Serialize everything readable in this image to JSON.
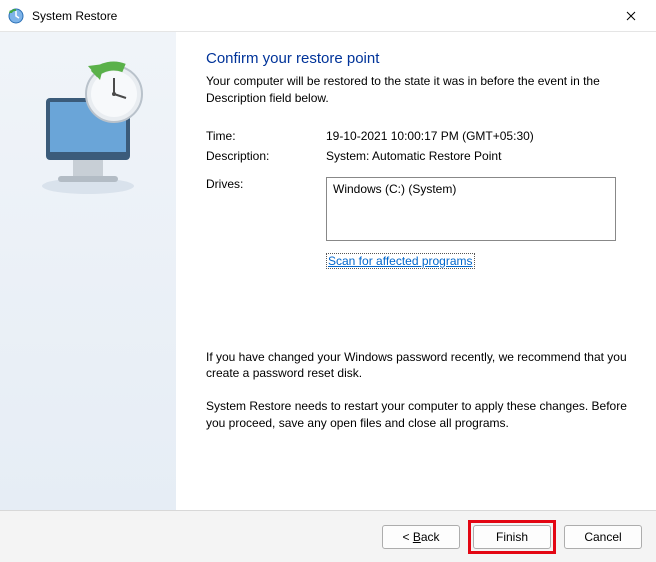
{
  "titlebar": {
    "app_name": "System Restore"
  },
  "heading": "Confirm your restore point",
  "subheading": "Your computer will be restored to the state it was in before the event in the Description field below.",
  "fields": {
    "time_label": "Time:",
    "time_value": "19-10-2021 10:00:17 PM (GMT+05:30)",
    "desc_label": "Description:",
    "desc_value": "System: Automatic Restore Point",
    "drives_label": "Drives:"
  },
  "drives": {
    "value": "Windows (C:) (System)"
  },
  "scan_link": "Scan for affected programs",
  "note1": "If you have changed your Windows password recently, we recommend that you create a password reset disk.",
  "note2": "System Restore needs to restart your computer to apply these changes. Before you proceed, save any open files and close all programs.",
  "buttons": {
    "back_prefix": "< ",
    "back_mn": "B",
    "back_suffix": "ack",
    "finish": "Finish",
    "cancel": "Cancel"
  }
}
